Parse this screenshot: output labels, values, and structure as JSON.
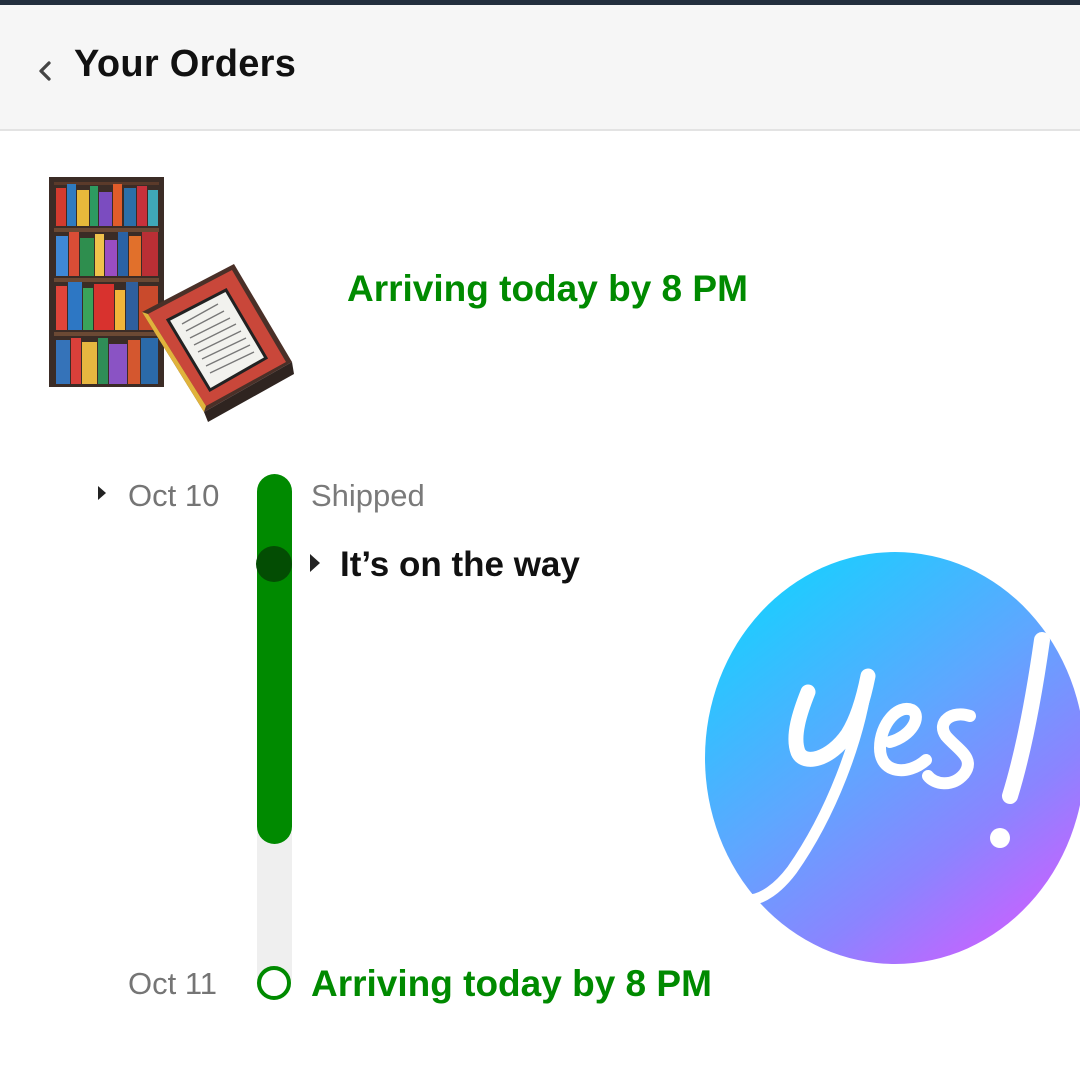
{
  "header": {
    "back_icon": "chevron-left-icon",
    "title": "Your Orders"
  },
  "order": {
    "product_image": "bookshelf-pattern-tablet-case",
    "arrival_status": "Arriving today by 8 PM"
  },
  "tracking": {
    "steps": [
      {
        "date": "Oct 10",
        "label": "Shipped"
      },
      {
        "date": "",
        "label": "It’s on the way"
      },
      {
        "date": "Oct 11",
        "label": "Arriving today by 8 PM"
      }
    ],
    "progress": 0.72
  },
  "sticker": {
    "text": "Yes!",
    "colors": [
      "#12d3ff",
      "#5ea7ff",
      "#8b84ff",
      "#d45bff"
    ]
  },
  "colors": {
    "green": "#008a00",
    "dark_green": "#034d03",
    "header_bg": "#f6f6f6"
  }
}
